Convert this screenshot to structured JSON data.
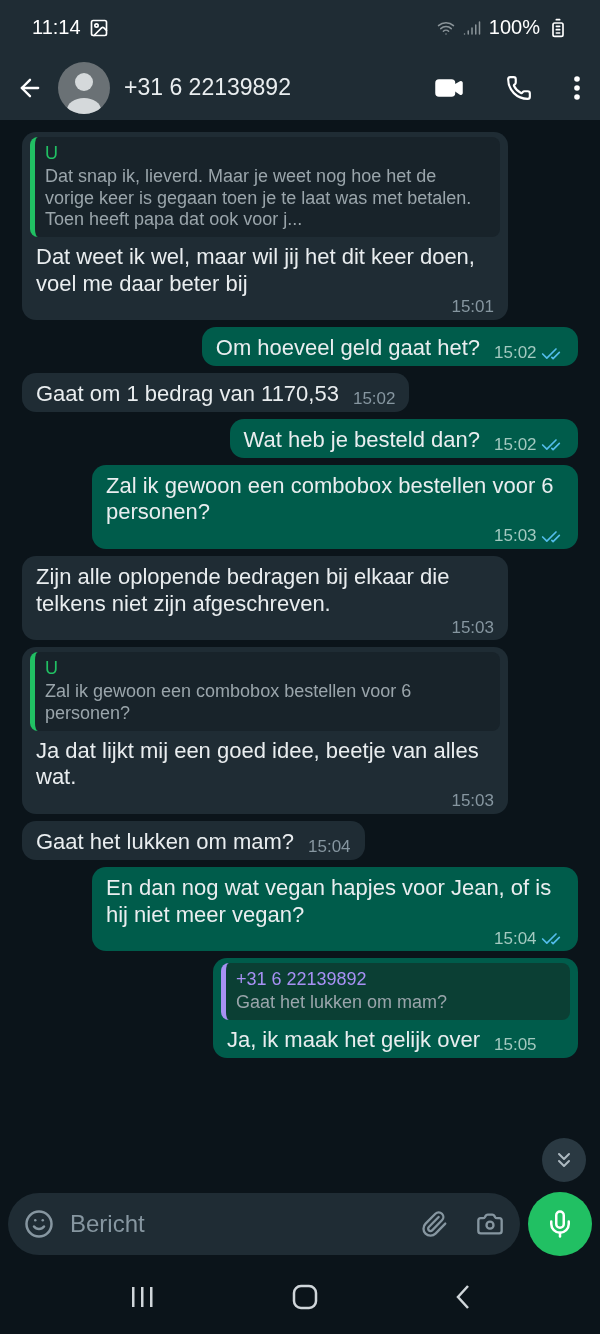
{
  "status_bar": {
    "time": "11:14",
    "battery": "100%"
  },
  "header": {
    "contact": "+31 6 22139892"
  },
  "messages": [
    {
      "outgoing": false,
      "quote": {
        "author": "U",
        "text": "Dat snap ik, lieverd. Maar je weet nog hoe het de vorige keer is gegaan toen je te laat was met betalen. Toen heeft papa dat ook voor j...",
        "color": "#21c063"
      },
      "text": "Dat weet ik wel, maar wil jij het dit keer doen, voel me daar beter bij",
      "time": "15:01"
    },
    {
      "outgoing": true,
      "text": "Om hoeveel geld gaat het?",
      "time": "15:02",
      "read": true
    },
    {
      "outgoing": false,
      "text": "Gaat om 1 bedrag van 1170,53",
      "time": "15:02"
    },
    {
      "outgoing": true,
      "text": "Wat heb je besteld dan?",
      "time": "15:02",
      "read": true
    },
    {
      "outgoing": true,
      "text": "Zal ik gewoon een combobox bestellen voor 6 personen?",
      "time": "15:03",
      "read": true
    },
    {
      "outgoing": false,
      "text": "Zijn alle oplopende bedragen bij elkaar die telkens niet zijn afgeschreven.",
      "time": "15:03"
    },
    {
      "outgoing": false,
      "quote": {
        "author": "U",
        "text": "Zal ik gewoon een combobox bestellen voor 6 personen?",
        "color": "#21c063"
      },
      "text": "Ja dat lijkt mij een goed idee, beetje van alles wat.",
      "time": "15:03"
    },
    {
      "outgoing": false,
      "text": "Gaat het lukken om mam?",
      "time": "15:04"
    },
    {
      "outgoing": true,
      "text": "En dan nog wat vegan hapjes voor Jean, of is hij niet meer vegan?",
      "time": "15:04",
      "read": true
    },
    {
      "outgoing": true,
      "quote": {
        "author": "+31 6 22139892",
        "text": "Gaat het lukken om mam?",
        "color": "#a791f4"
      },
      "text": "Ja, ik maak het gelijk over",
      "time": "15:05"
    }
  ],
  "composer": {
    "placeholder": "Bericht"
  }
}
